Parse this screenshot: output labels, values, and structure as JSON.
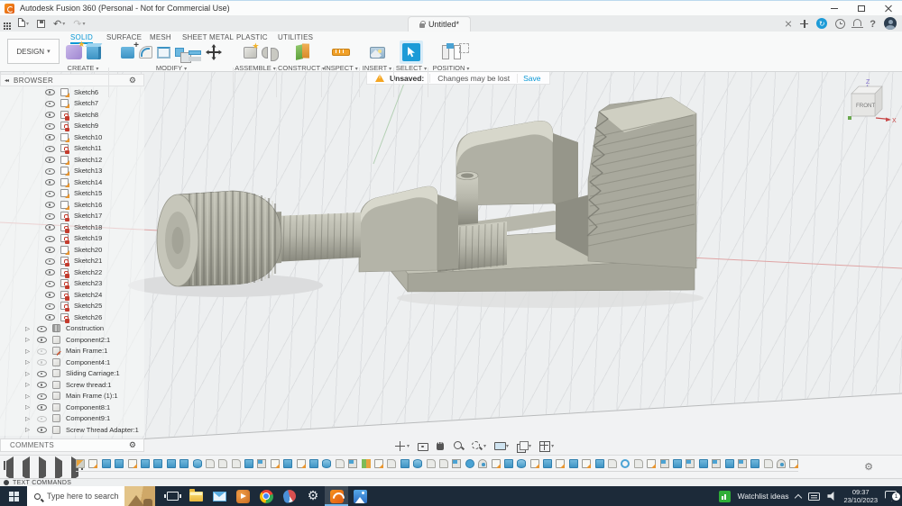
{
  "title_bar": {
    "app_title": "Autodesk Fusion 360 (Personal - Not for Commercial Use)"
  },
  "tab_strip": {
    "document_tab": "Untitled*"
  },
  "ribbon": {
    "design_label": "DESIGN",
    "tabs": [
      "SOLID",
      "SURFACE",
      "MESH",
      "SHEET METAL",
      "PLASTIC",
      "UTILITIES"
    ],
    "active_tab": "SOLID",
    "groups": [
      {
        "label": "CREATE"
      },
      {
        "label": "MODIFY"
      },
      {
        "label": "ASSEMBLE"
      },
      {
        "label": "CONSTRUCT"
      },
      {
        "label": "INSPECT"
      },
      {
        "label": "INSERT"
      },
      {
        "label": "SELECT"
      },
      {
        "label": "POSITION"
      }
    ]
  },
  "unsaved": {
    "label": "Unsaved:",
    "message": "Changes may be lost",
    "save_label": "Save"
  },
  "browser": {
    "header": "BROWSER",
    "sketches": [
      {
        "label": "Sketch6",
        "locked": false
      },
      {
        "label": "Sketch7",
        "locked": false
      },
      {
        "label": "Sketch8",
        "locked": true
      },
      {
        "label": "Sketch9",
        "locked": true
      },
      {
        "label": "Sketch10",
        "locked": false
      },
      {
        "label": "Sketch11",
        "locked": true
      },
      {
        "label": "Sketch12",
        "locked": false
      },
      {
        "label": "Sketch13",
        "locked": false
      },
      {
        "label": "Sketch14",
        "locked": false
      },
      {
        "label": "Sketch15",
        "locked": false
      },
      {
        "label": "Sketch16",
        "locked": false
      },
      {
        "label": "Sketch17",
        "locked": true
      },
      {
        "label": "Sketch18",
        "locked": true
      },
      {
        "label": "Sketch19",
        "locked": true
      },
      {
        "label": "Sketch20",
        "locked": false
      },
      {
        "label": "Sketch21",
        "locked": true
      },
      {
        "label": "Sketch22",
        "locked": true
      },
      {
        "label": "Sketch23",
        "locked": true
      },
      {
        "label": "Sketch24",
        "locked": true
      },
      {
        "label": "Sketch25",
        "locked": true
      },
      {
        "label": "Sketch26",
        "locked": true
      }
    ],
    "nodes": [
      {
        "label": "Construction",
        "icon": "folder",
        "dim": false,
        "edited": false
      },
      {
        "label": "Component2:1",
        "icon": "box",
        "dim": false,
        "edited": false
      },
      {
        "label": "Main Frame:1",
        "icon": "box",
        "dim": true,
        "edited": true
      },
      {
        "label": "Component4:1",
        "icon": "box",
        "dim": true,
        "edited": false
      },
      {
        "label": "Sliding Carriage:1",
        "icon": "box",
        "dim": false,
        "edited": false
      },
      {
        "label": "Screw thread:1",
        "icon": "box",
        "dim": false,
        "edited": false
      },
      {
        "label": "Main Frame (1):1",
        "icon": "box",
        "dim": false,
        "edited": false
      },
      {
        "label": "Component8:1",
        "icon": "box",
        "dim": false,
        "edited": false
      },
      {
        "label": "Component9:1",
        "icon": "box",
        "dim": true,
        "edited": false
      },
      {
        "label": "Screw Thread Adapter:1",
        "icon": "box",
        "dim": false,
        "edited": false
      }
    ]
  },
  "viewcube": {
    "face": "FRONT",
    "axis_z": "Z",
    "axis_x": "X"
  },
  "comments": {
    "title": "COMMENTS"
  },
  "navbar": {
    "items": [
      "pan",
      "look-at",
      "pan-hand",
      "zoom",
      "fit",
      "display-settings",
      "grid-and-snaps",
      "viewports"
    ],
    "with_caret": [
      "pan",
      "fit",
      "display-settings",
      "grid-and-snaps",
      "viewports"
    ]
  },
  "timeline": {
    "icons": [
      "eraser",
      "sketch",
      "extrude",
      "extrude",
      "sketch",
      "extrude",
      "extrude",
      "extrude",
      "extrude",
      "cyl",
      "doc",
      "doc",
      "doc",
      "extrude",
      "flag",
      "sketch",
      "extrude",
      "sketch",
      "extrude",
      "cyl",
      "doc",
      "flag",
      "construct",
      "sketch",
      "doc",
      "extrude",
      "cyl",
      "doc",
      "doc",
      "flag",
      "move",
      "joint",
      "sketch",
      "extrude",
      "cyl",
      "sketch",
      "extrude",
      "sketch",
      "extrude",
      "sketch",
      "extrude",
      "doc",
      "ring",
      "doc",
      "sketch",
      "flag",
      "extrude",
      "flag",
      "extrude",
      "flag",
      "extrude",
      "flag",
      "extrude",
      "doc",
      "joint",
      "sketch"
    ]
  },
  "text_commands": {
    "label": "TEXT COMMANDS"
  },
  "taskbar": {
    "search_placeholder": "Type here to search",
    "apps": [
      "task-view",
      "file-explorer",
      "mail",
      "media-app",
      "chrome",
      "paint-3d",
      "settings",
      "fusion-360",
      "photos"
    ],
    "active_app": "fusion-360",
    "tray": {
      "agent_text": "Watchlist ideas",
      "time": "09:37",
      "date": "23/10/2023",
      "notification_count": "1"
    }
  }
}
